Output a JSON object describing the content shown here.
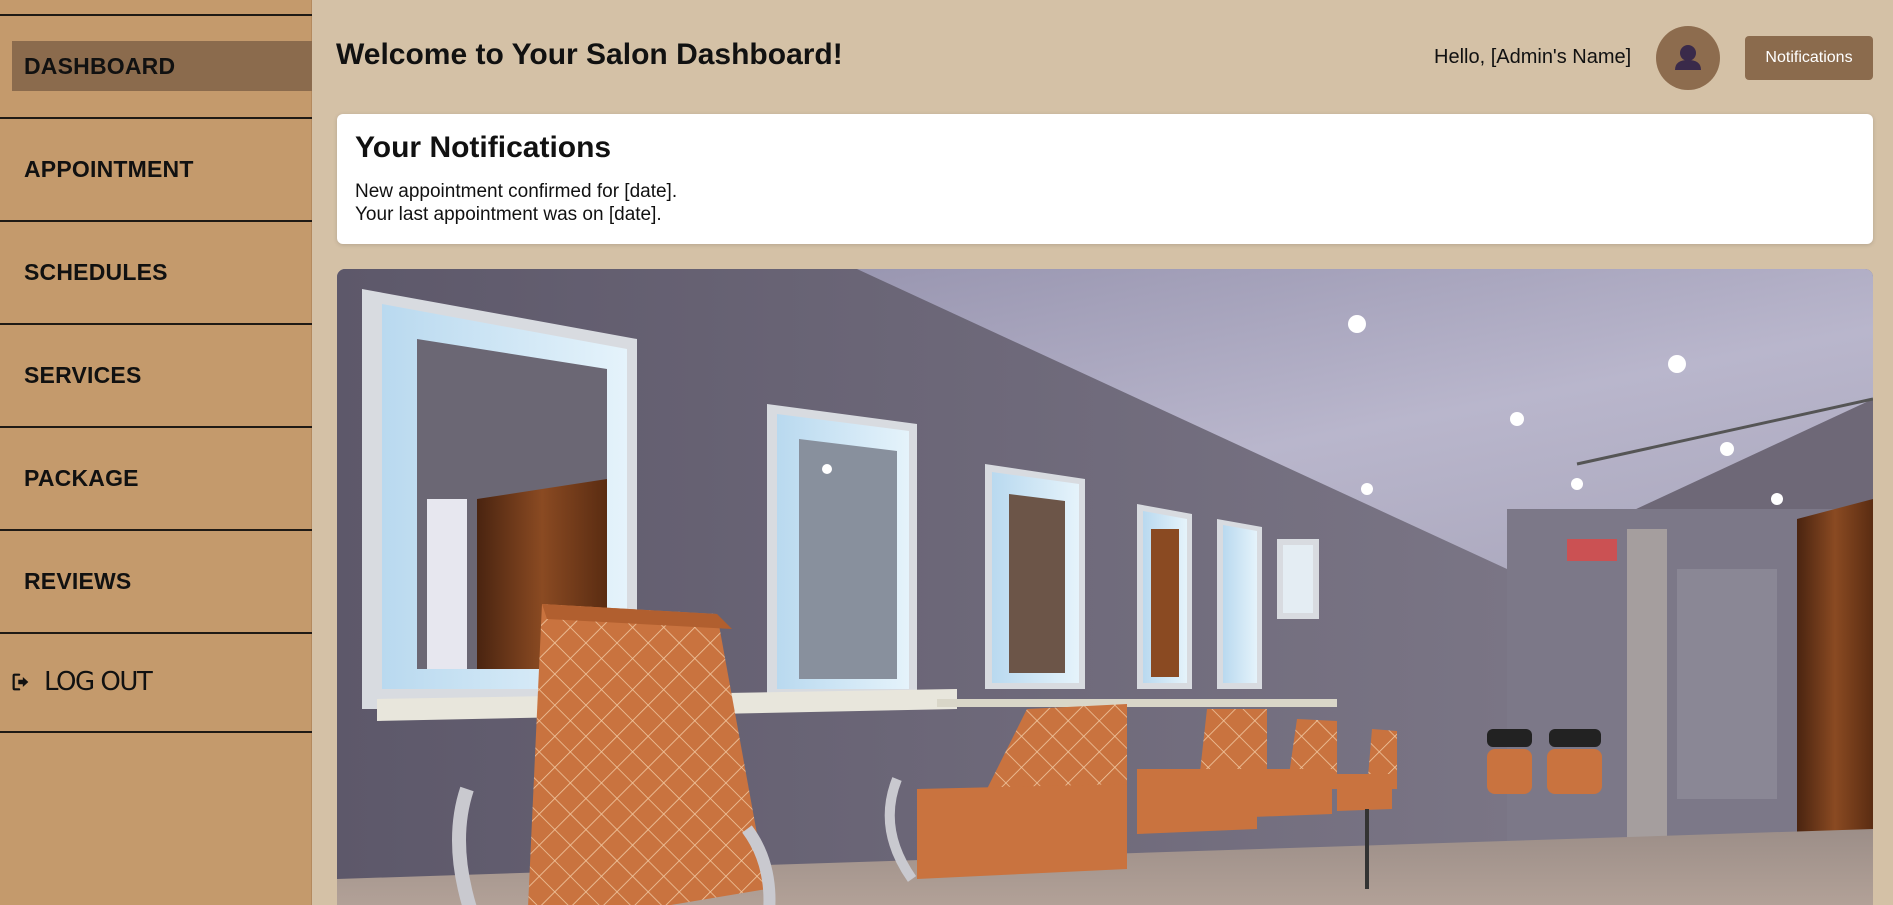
{
  "sidebar": {
    "items": [
      {
        "label": "DASHBOARD",
        "active": true
      },
      {
        "label": "APPOINTMENT"
      },
      {
        "label": "SCHEDULES"
      },
      {
        "label": "SERVICES"
      },
      {
        "label": "PACKAGE"
      },
      {
        "label": "REVIEWS"
      }
    ],
    "logout": {
      "label": "LOG OUT",
      "icon": "sign-out-icon"
    }
  },
  "header": {
    "title": "Welcome to Your Salon Dashboard!",
    "greeting": "Hello, [Admin's Name]",
    "avatar_icon": "user-icon",
    "notifications_button": "Notifications"
  },
  "notifications": {
    "title": "Your Notifications",
    "items": [
      "New appointment confirmed for [date].",
      "Your last appointment was on [date]."
    ]
  },
  "hero": {
    "subject": "salon-interior-photo"
  },
  "colors": {
    "page_bg": "#d4c1a6",
    "sidebar_bg": "#c49a6c",
    "accent": "#8b6b4d",
    "divider": "#1f1a15"
  }
}
